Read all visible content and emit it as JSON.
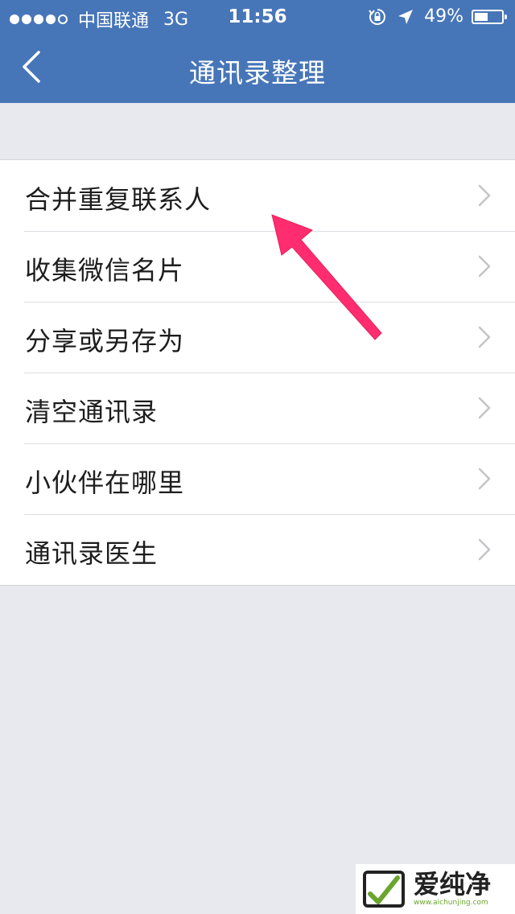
{
  "status_bar": {
    "carrier": "中国联通",
    "network": "3G",
    "time": "11:56",
    "battery_percent": "49%",
    "battery_level": 0.49
  },
  "navbar": {
    "title": "通讯录整理",
    "back_icon": "chevron-left-icon"
  },
  "menu": {
    "items": [
      {
        "label": "合并重复联系人"
      },
      {
        "label": "收集微信名片"
      },
      {
        "label": "分享或另存为"
      },
      {
        "label": "清空通讯录"
      },
      {
        "label": "小伙伴在哪里"
      },
      {
        "label": "通讯录医生"
      }
    ],
    "chevron_icon": "chevron-right-icon"
  },
  "watermark": {
    "name": "爱纯净",
    "url": "www.aichunjing.com"
  },
  "colors": {
    "header": "#4776b8",
    "background": "#e8e9ee",
    "arrow": "#ff2d6f",
    "watermark_green": "#6aa52e"
  }
}
